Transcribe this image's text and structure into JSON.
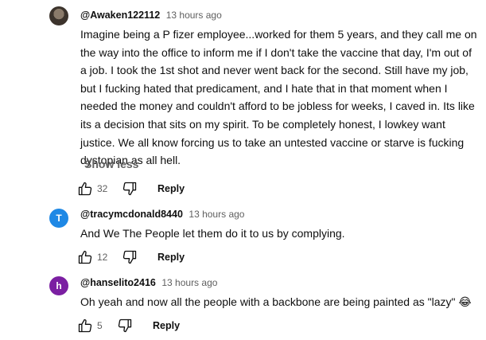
{
  "comments": [
    {
      "avatar": "profile-photo",
      "handle": "@Awaken122112",
      "time": "13 hours ago",
      "lines": [
        "Imagine being a P fizer employee...worked for them 5 years, and they call me on",
        "the way into the office to inform me if I don't take the vaccine that day, I'm out of",
        "a job. I took the 1st shot and never went back for the second. Still have my job,",
        "but I fucking hated that predicament, and I hate that in that moment when I",
        "needed the money and couldn't afford to be jobless for weeks, I caved in. Its like",
        "its a decision that sits on my spirit. To be completely honest, I lowkey want",
        "justice. We all know forcing us to take an untested vaccine or starve is fucking",
        "dystopian as all hell."
      ],
      "show_less": "Show less",
      "likes": "32",
      "reply": "Reply"
    },
    {
      "avatar_letter": "T",
      "avatar_color": "#1e88e5",
      "handle": "@tracymcdonald8440",
      "time": "13 hours ago",
      "text": "And We The People let them do it to us by complying.",
      "likes": "12",
      "reply": "Reply"
    },
    {
      "avatar_letter": "h",
      "avatar_color": "#7b1fa2",
      "handle": "@hanselito2416",
      "time": "13 hours ago",
      "text": "Oh yeah and now all the people with a backbone are being painted as \"lazy\" 😂",
      "likes": "5",
      "reply": "Reply"
    }
  ],
  "icons": {
    "like": "thumbs-up-icon",
    "dislike": "thumbs-down-icon"
  }
}
